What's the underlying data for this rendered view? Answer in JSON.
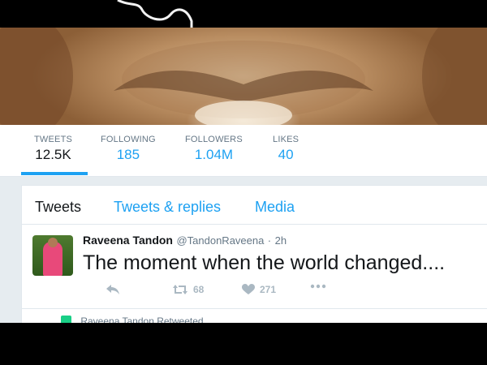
{
  "stats": [
    {
      "label": "TWEETS",
      "value": "12.5K"
    },
    {
      "label": "FOLLOWING",
      "value": "185"
    },
    {
      "label": "FOLLOWERS",
      "value": "1.04M"
    },
    {
      "label": "LIKES",
      "value": "40"
    }
  ],
  "tabs": [
    {
      "label": "Tweets"
    },
    {
      "label": "Tweets & replies"
    },
    {
      "label": "Media"
    }
  ],
  "tweet": {
    "name": "Raveena Tandon",
    "handle": "@TandonRaveena",
    "separator": "·",
    "time": "2h",
    "text": "The moment when the world changed....",
    "retweets": "68",
    "likes": "271"
  },
  "next_item": {
    "retweeted_by": "Raveena Tandon Retweeted"
  },
  "colors": {
    "accent": "#1da1f2",
    "text_primary": "#14171a",
    "text_secondary": "#657786",
    "retweet_green": "#19cf86"
  }
}
